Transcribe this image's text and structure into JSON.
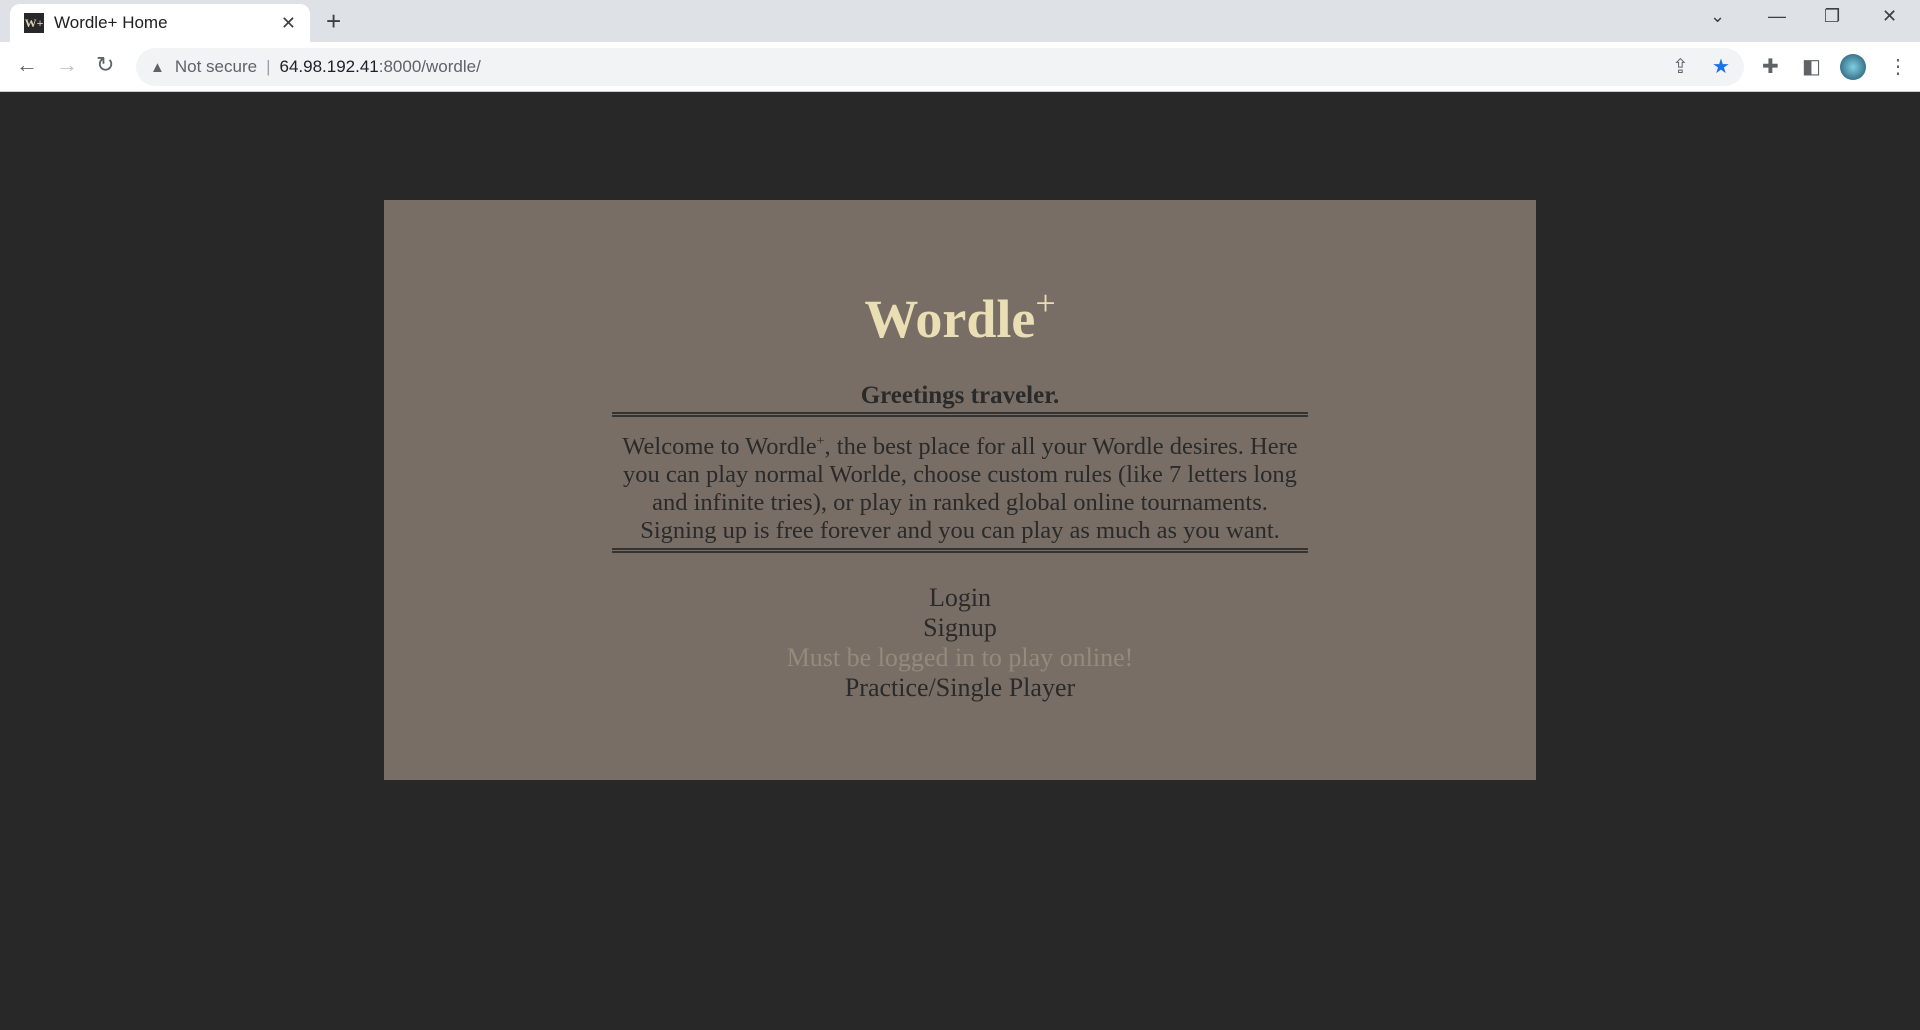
{
  "browser": {
    "tab_title": "Wordle+ Home",
    "favicon_text": "W+",
    "security_label": "Not secure",
    "url_host": "64.98.192.41",
    "url_path": ":8000/wordle/"
  },
  "page": {
    "title": "Wordle",
    "title_sup": "+",
    "greeting": "Greetings traveler.",
    "intro_pre": "Welcome to Wordle",
    "intro_sup": "+",
    "intro_post": ", the best place for all your Wordle desires. Here you can play normal Worlde, choose custom rules (like 7 letters long and infinite tries), or play in ranked global online tournaments. Signing up is free forever and you can play as much as you want.",
    "links": {
      "login": "Login",
      "signup": "Signup",
      "online_disabled": "Must be logged in to play online!",
      "practice": "Practice/Single Player"
    }
  }
}
